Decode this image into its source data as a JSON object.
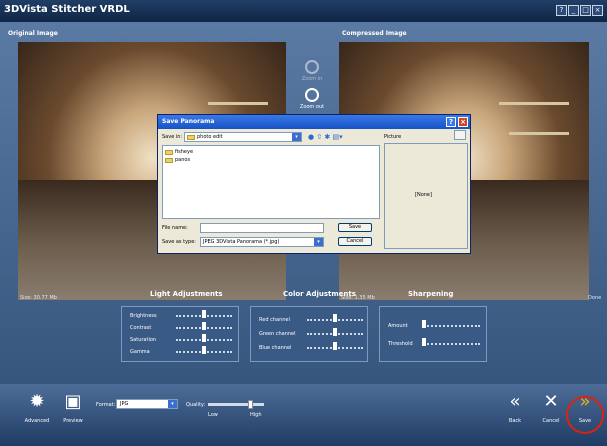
{
  "window": {
    "title": "3DVista Stitcher VRDL",
    "controls": [
      "?",
      "_",
      "□",
      "×"
    ]
  },
  "panes": {
    "original": {
      "heading": "Original Image",
      "size": "Size: 30.77 Mb"
    },
    "compressed": {
      "heading": "Compressed Image",
      "size": "Size: 1.35 Mb",
      "status": "Done"
    }
  },
  "tools": {
    "zoom_in": "Zoom in",
    "zoom_out": "Zoom out"
  },
  "adjustments": {
    "light": {
      "heading": "Light Adjustments",
      "rows": [
        "Brightness",
        "Contrast",
        "Saturation",
        "Gamma"
      ],
      "levels": [
        0.5,
        0.5,
        0.5,
        0.5
      ]
    },
    "color": {
      "heading": "Color Adjustments",
      "rows": [
        "Red channel",
        "Green channel",
        "Blue channel"
      ],
      "levels": [
        0.5,
        0.5,
        0.5
      ]
    },
    "sharpening": {
      "heading": "Sharpening",
      "rows": [
        "Amount",
        "Threshold"
      ],
      "levels": [
        0.0,
        0.0
      ]
    }
  },
  "dialog": {
    "title": "Save Panorama",
    "save_in_label": "Save in:",
    "save_in_value": "photo edit",
    "folders": [
      "fisheye",
      "panos"
    ],
    "preview_label": "Picture",
    "preview_value": "[None]",
    "filename_label": "File name:",
    "filename_value": "",
    "savetype_label": "Save as type:",
    "savetype_value": "JPEG 3DVista Panorama (*.jpg)",
    "save_button": "Save",
    "cancel_button": "Cancel"
  },
  "bottom": {
    "advanced": "Advanced",
    "preview": "Preview",
    "format_label": "Format:",
    "format_value": "JPG",
    "quality_label": "Quality:",
    "quality_low": "Low",
    "quality_high": "High",
    "quality_level": 0.75,
    "back": "Back",
    "cancel": "Cancel",
    "save": "Save"
  },
  "colors": {
    "highlight_circle": "#dd2211",
    "accent": "#f0b020"
  }
}
